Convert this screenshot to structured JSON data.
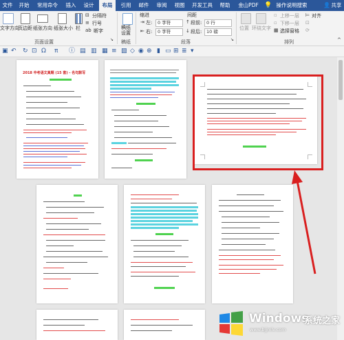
{
  "tabs": [
    "文件",
    "开始",
    "常用命令",
    "插入",
    "设计",
    "布局",
    "引用",
    "邮件",
    "审阅",
    "视图",
    "开发工具",
    "帮助",
    "金山PDF",
    "操作说明搜索",
    "共享"
  ],
  "ribbon": {
    "page_setup": {
      "text_direction": "文字方向",
      "margins": "页边距",
      "orientation": "纸张方向",
      "size": "纸张大小",
      "columns": "栏",
      "breaks": "分隔符",
      "line_numbers": "行号",
      "hyphenation": "断字",
      "group_label": "页面设置"
    },
    "paper": {
      "draft": "稿纸\n设置",
      "group_label": "稿纸"
    },
    "paragraph": {
      "indent_title": "缩进",
      "spacing_title": "间距",
      "left_label": "左:",
      "left_value": "0 字符",
      "right_label": "右:",
      "right_value": "0 字符",
      "before_label": "段前:",
      "before_value": "0 行",
      "after_label": "段后:",
      "after_value": "10 磅",
      "group_label": "段落"
    },
    "arrange": {
      "position": "位置",
      "wrap_text": "环绕文字",
      "bring_forward": "上移一层",
      "send_backward": "下移一层",
      "selection_pane": "选择窗格",
      "align": "对齐",
      "group_label": "排列"
    }
  },
  "doc": {
    "page1_title": "2018 中考语文真题 (15 套) - 名句默写"
  },
  "watermark": {
    "brand": "Windows",
    "cn": "系统之家",
    "url": "www.bjjmlv.com"
  },
  "colors": {
    "accent": "#2b579a",
    "callout": "#d91f1f"
  }
}
